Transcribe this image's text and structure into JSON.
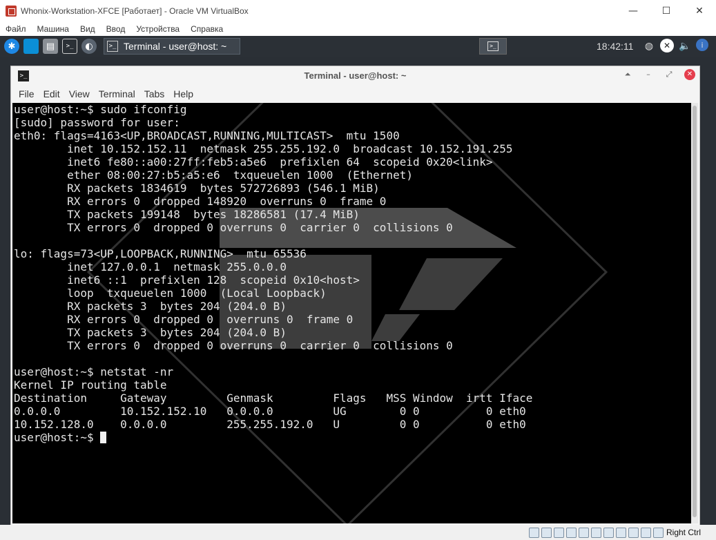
{
  "host_window": {
    "title": "Whonix-Workstation-XFCE [Работает] - Oracle VM VirtualBox",
    "controls": {
      "minimize": "—",
      "maximize": "☐",
      "close": "✕"
    },
    "menu": [
      "Файл",
      "Машина",
      "Вид",
      "Ввод",
      "Устройства",
      "Справка"
    ]
  },
  "guest_panel": {
    "task_label": "Terminal - user@host: ~",
    "terminal_glyph": ">_",
    "clock": "18:42:11"
  },
  "terminal": {
    "title": "Terminal - user@host: ~",
    "glyph": ">_",
    "menu": [
      "File",
      "Edit",
      "View",
      "Terminal",
      "Tabs",
      "Help"
    ],
    "lines": [
      "user@host:~$ sudo ifconfig",
      "[sudo] password for user:",
      "eth0: flags=4163<UP,BROADCAST,RUNNING,MULTICAST>  mtu 1500",
      "        inet 10.152.152.11  netmask 255.255.192.0  broadcast 10.152.191.255",
      "        inet6 fe80::a00:27ff:feb5:a5e6  prefixlen 64  scopeid 0x20<link>",
      "        ether 08:00:27:b5:a5:e6  txqueuelen 1000  (Ethernet)",
      "        RX packets 1834619  bytes 572726893 (546.1 MiB)",
      "        RX errors 0  dropped 148920  overruns 0  frame 0",
      "        TX packets 199148  bytes 18286581 (17.4 MiB)",
      "        TX errors 0  dropped 0 overruns 0  carrier 0  collisions 0",
      "",
      "lo: flags=73<UP,LOOPBACK,RUNNING>  mtu 65536",
      "        inet 127.0.0.1  netmask 255.0.0.0",
      "        inet6 ::1  prefixlen 128  scopeid 0x10<host>",
      "        loop  txqueuelen 1000  (Local Loopback)",
      "        RX packets 3  bytes 204 (204.0 B)",
      "        RX errors 0  dropped 0  overruns 0  frame 0",
      "        TX packets 3  bytes 204 (204.0 B)",
      "        TX errors 0  dropped 0 overruns 0  carrier 0  collisions 0",
      "",
      "user@host:~$ netstat -nr",
      "Kernel IP routing table",
      "Destination     Gateway         Genmask         Flags   MSS Window  irtt Iface",
      "0.0.0.0         10.152.152.10   0.0.0.0         UG        0 0          0 eth0",
      "10.152.128.0    0.0.0.0         255.255.192.0   U         0 0          0 eth0"
    ],
    "prompt": "user@host:~$ "
  },
  "host_statusbar": {
    "host_key": "Right Ctrl"
  },
  "colors": {
    "terminal_bg": "#000000",
    "terminal_fg": "#e6e6e6",
    "panel_bg": "#2b3036",
    "close_button": "#e53e4d"
  }
}
